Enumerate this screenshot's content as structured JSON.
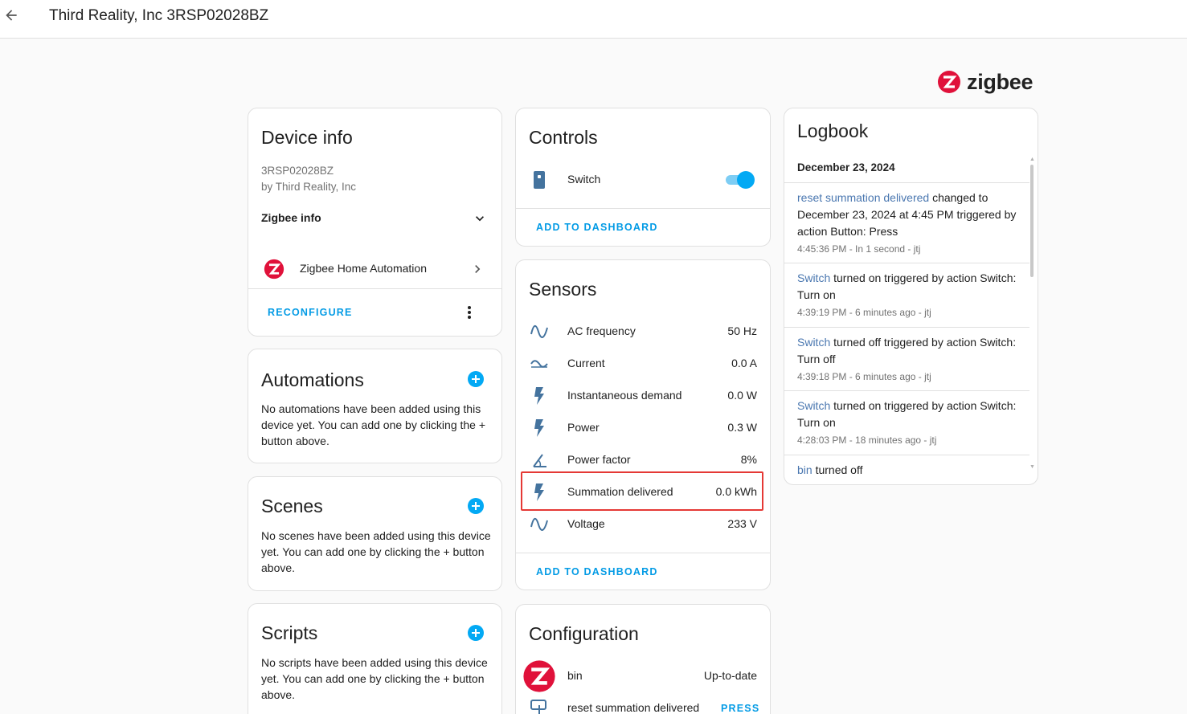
{
  "header": {
    "title": "Third Reality, Inc 3RSP02028BZ"
  },
  "logo": {
    "text": "zigbee"
  },
  "device_info": {
    "title": "Device info",
    "model": "3RSP02028BZ",
    "manufacturer": "by Third Reality, Inc",
    "zigbee_info_label": "Zigbee info",
    "integration_label": "Zigbee Home Automation",
    "reconfigure_label": "RECONFIGURE"
  },
  "automations": {
    "title": "Automations",
    "text": "No automations have been added using this device yet. You can add one by clicking the + button above."
  },
  "scenes": {
    "title": "Scenes",
    "text": "No scenes have been added using this device yet. You can add one by clicking the + button above."
  },
  "scripts": {
    "title": "Scripts",
    "text": "No scripts have been added using this device yet. You can add one by clicking the + button above."
  },
  "controls": {
    "title": "Controls",
    "switch_label": "Switch",
    "switch_on": true,
    "add_to_dashboard": "ADD TO DASHBOARD"
  },
  "sensors": {
    "title": "Sensors",
    "rows": [
      {
        "icon": "sine-wave-icon",
        "label": "AC frequency",
        "value": "50 Hz"
      },
      {
        "icon": "current-ac-icon",
        "label": "Current",
        "value": "0.0 A"
      },
      {
        "icon": "flash-icon",
        "label": "Instantaneous demand",
        "value": "0.0 W"
      },
      {
        "icon": "flash-icon",
        "label": "Power",
        "value": "0.3 W"
      },
      {
        "icon": "angle-icon",
        "label": "Power factor",
        "value": "8%"
      },
      {
        "icon": "flash-icon",
        "label": "Summation delivered",
        "value": "0.0 kWh"
      },
      {
        "icon": "sine-wave-icon",
        "label": "Voltage",
        "value": "233 V"
      }
    ],
    "add_to_dashboard": "ADD TO DASHBOARD"
  },
  "configuration": {
    "title": "Configuration",
    "rows": [
      {
        "label": "bin",
        "value": "Up-to-date"
      },
      {
        "label": "reset summation delivered",
        "action": "PRESS"
      }
    ]
  },
  "logbook": {
    "title": "Logbook",
    "date": "December 23, 2024",
    "entries": [
      {
        "entity": "reset summation delivered",
        "message": " changed to December 23, 2024 at 4:45 PM triggered by action Button: Press",
        "meta": "4:45:36 PM - In 1 second - jtj"
      },
      {
        "entity": "Switch",
        "message": " turned on triggered by action Switch: Turn on",
        "meta": "4:39:19 PM - 6 minutes ago - jtj"
      },
      {
        "entity": "Switch",
        "message": " turned off triggered by action Switch: Turn off",
        "meta": "4:39:18 PM - 6 minutes ago - jtj"
      },
      {
        "entity": "Switch",
        "message": " turned on triggered by action Switch: Turn on",
        "meta": "4:28:03 PM - 18 minutes ago - jtj"
      },
      {
        "entity": "bin",
        "message": " turned off",
        "meta": ""
      }
    ]
  },
  "colors": {
    "accent": "#03a9f4",
    "link": "#4a77b0",
    "zigbee_red": "#e0113a",
    "highlight": "#e53935"
  }
}
